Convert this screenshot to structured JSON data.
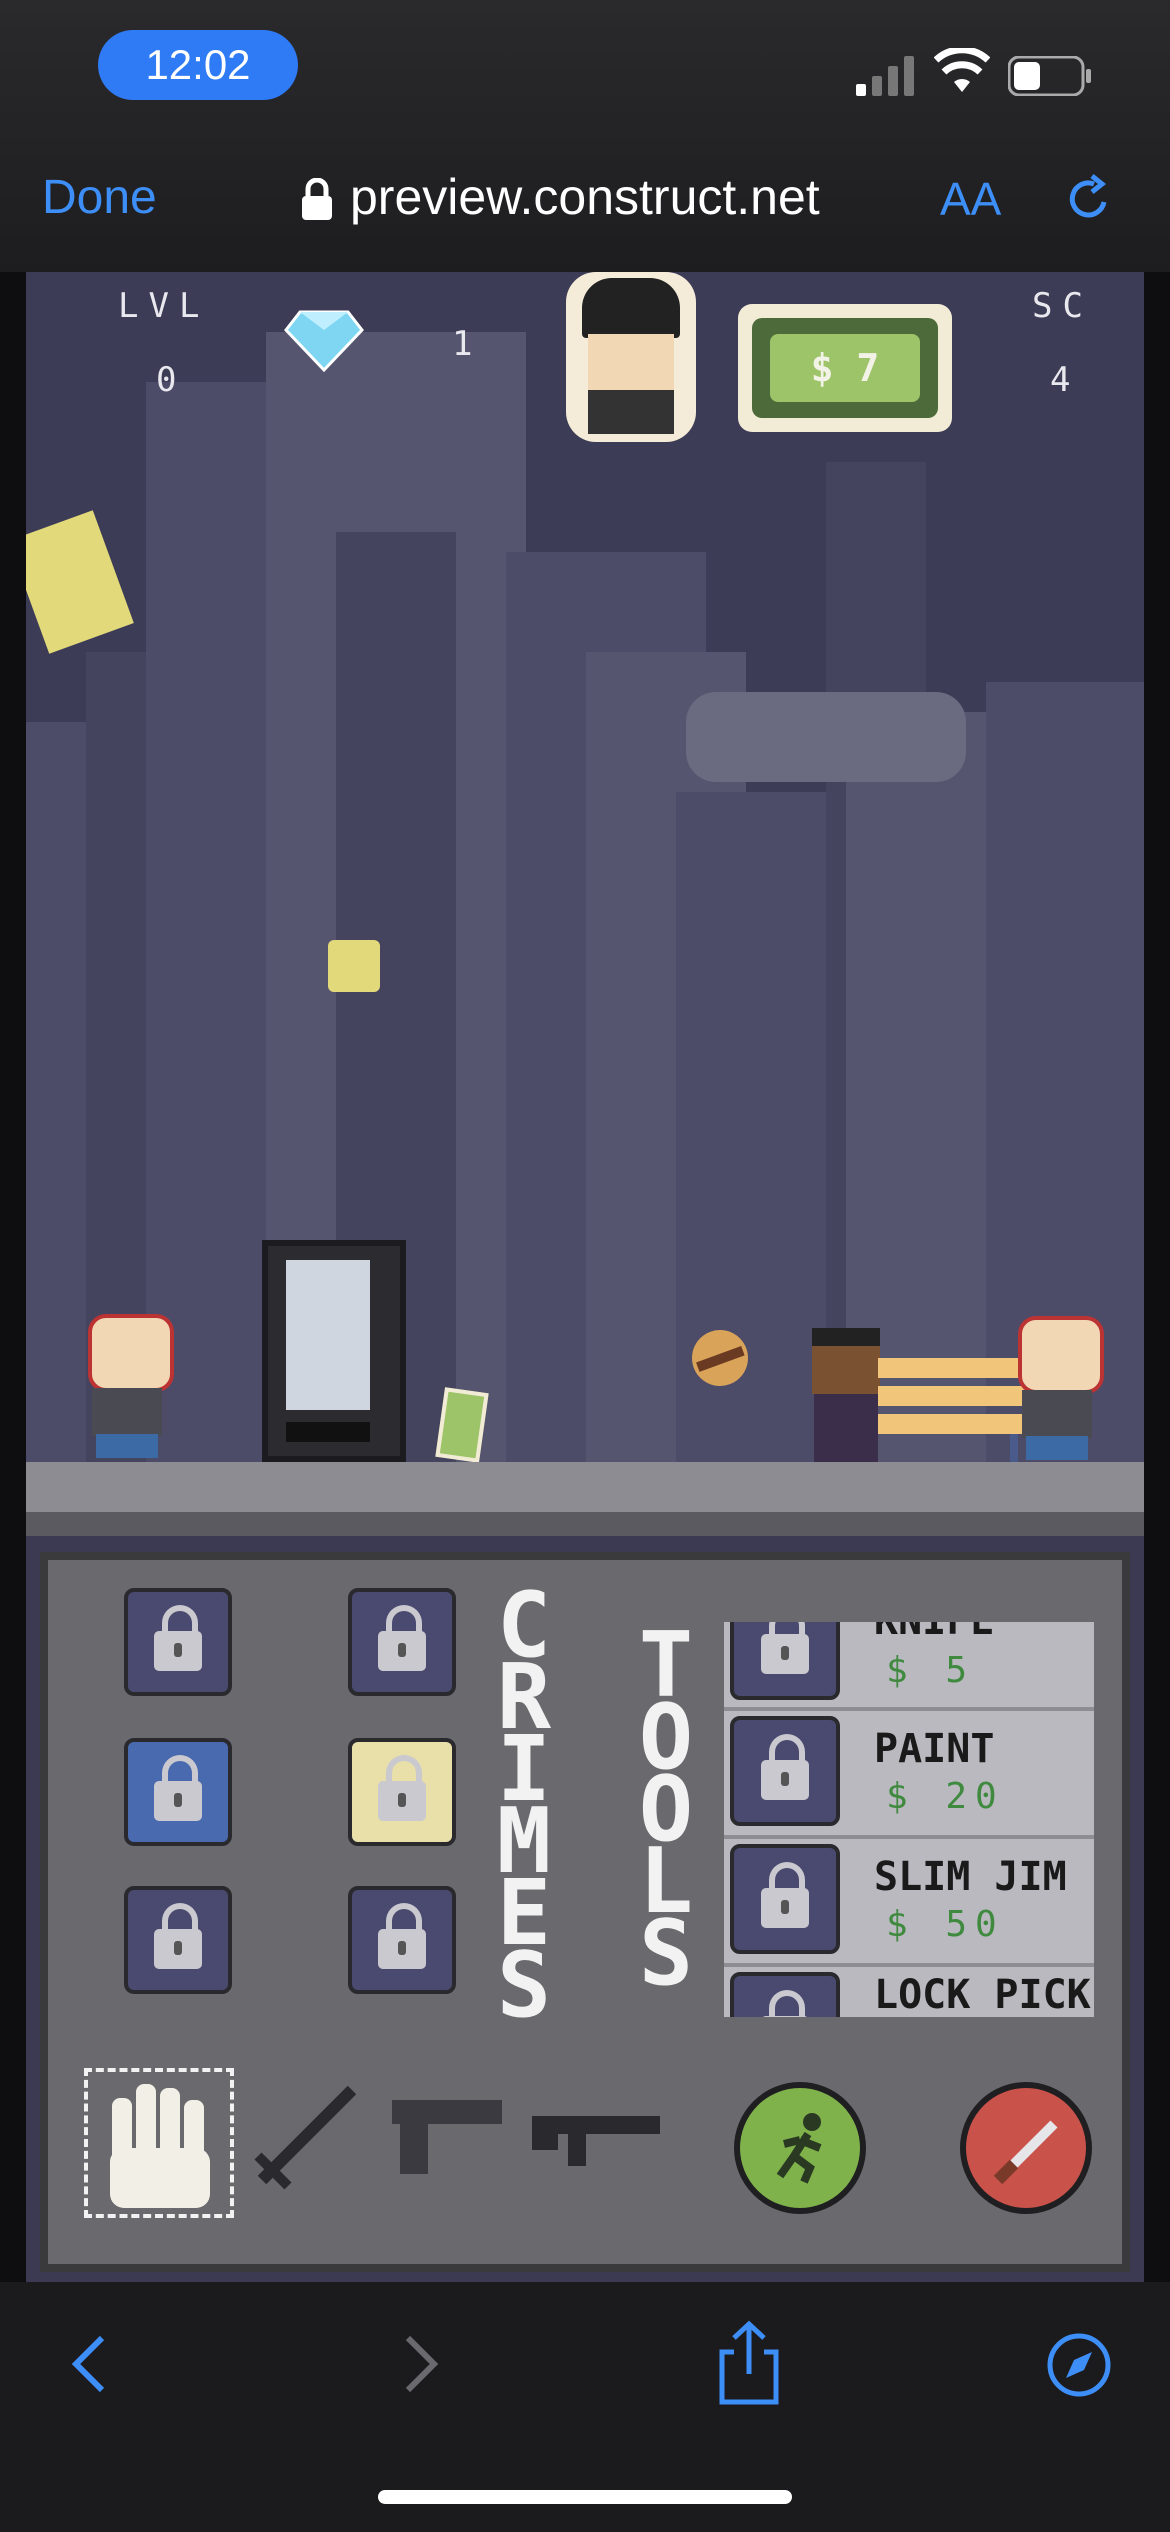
{
  "status_bar": {
    "time": "12:02"
  },
  "browser": {
    "done_label": "Done",
    "url": "preview.construct.net",
    "text_size_label": "AA",
    "icons": [
      "lock-icon",
      "reload-icon",
      "back-icon",
      "forward-icon",
      "share-icon",
      "compass-icon"
    ]
  },
  "hud": {
    "level_label": "LVL",
    "level_value": "0",
    "gem_count": "1",
    "money": "$ 7",
    "score_label": "SC",
    "score_value": "4"
  },
  "panel": {
    "crimes_label": "CRIMES",
    "tools_label": "TOOLS",
    "tools": [
      {
        "name": "KNIFE",
        "price": "$ 5"
      },
      {
        "name": "PAINT",
        "price": "$ 20"
      },
      {
        "name": "SLIM JIM",
        "price": "$ 50"
      },
      {
        "name": "LOCK PICK",
        "price": ""
      }
    ],
    "weapons": [
      "fist-icon",
      "sword-icon",
      "pistol-icon",
      "rifle-icon",
      "run-button-icon",
      "attack-button-icon"
    ]
  },
  "colors": {
    "accent": "#3d8ef7",
    "money_green": "#9ec46a",
    "price_green": "#3f8a3f",
    "run_button": "#7fb24a",
    "attack_button": "#c9524a"
  }
}
